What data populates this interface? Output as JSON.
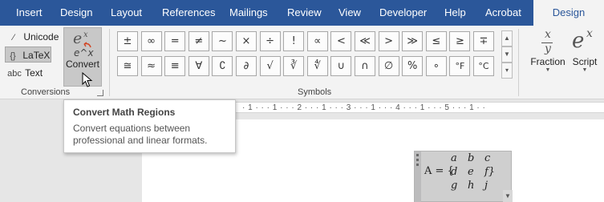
{
  "tabs": [
    {
      "label": "Insert"
    },
    {
      "label": "Design"
    },
    {
      "label": "Layout"
    },
    {
      "label": "References"
    },
    {
      "label": "Mailings"
    },
    {
      "label": "Review"
    },
    {
      "label": "View"
    },
    {
      "label": "Developer"
    },
    {
      "label": "Help"
    },
    {
      "label": "Acrobat"
    },
    {
      "label": "Design",
      "active": true
    }
  ],
  "conversions": {
    "options": [
      {
        "icon": "⁄",
        "label": "Unicode"
      },
      {
        "icon": "{}",
        "label": "LaTeX",
        "selected": true
      },
      {
        "icon": "abc",
        "label": "Text"
      }
    ],
    "convert_label": "Convert",
    "group_label": "Conversions"
  },
  "symbols": {
    "row1": [
      "±",
      "∞",
      "=",
      "≠",
      "~",
      "×",
      "÷",
      "!",
      "∝",
      "<",
      "≪",
      ">",
      "≫",
      "≤",
      "≥",
      "∓"
    ],
    "row2": [
      "≅",
      "≈",
      "≡",
      "∀",
      "∁",
      "∂",
      "√",
      "∛",
      "∜",
      "∪",
      "∩",
      "∅",
      "%",
      "∘",
      "°F",
      "°C"
    ],
    "group_label": "Symbols"
  },
  "structures": {
    "fraction": {
      "label": "Fraction",
      "num": "x",
      "den": "y"
    },
    "script": {
      "label": "Script",
      "base": "e",
      "sup": "x"
    }
  },
  "tooltip": {
    "title": "Convert Math Regions",
    "description": "Convert equations between professional and linear formats."
  },
  "ruler": {
    "text": "· 1 · · · 1 · · · 2 · · · 1 · · · 3 · · · 1 · · · 4 · · · 1 · · · 5 · · · 1 · ·"
  },
  "equation": {
    "lhs": "A = {",
    "rows": [
      [
        "a",
        "b",
        "c"
      ],
      [
        "d",
        "e",
        "f}"
      ],
      [
        "g",
        "h",
        "j"
      ]
    ]
  },
  "colors": {
    "accent": "#2b579a",
    "ribbon": "#f3f3f3",
    "selection": "#c8c8c8"
  }
}
